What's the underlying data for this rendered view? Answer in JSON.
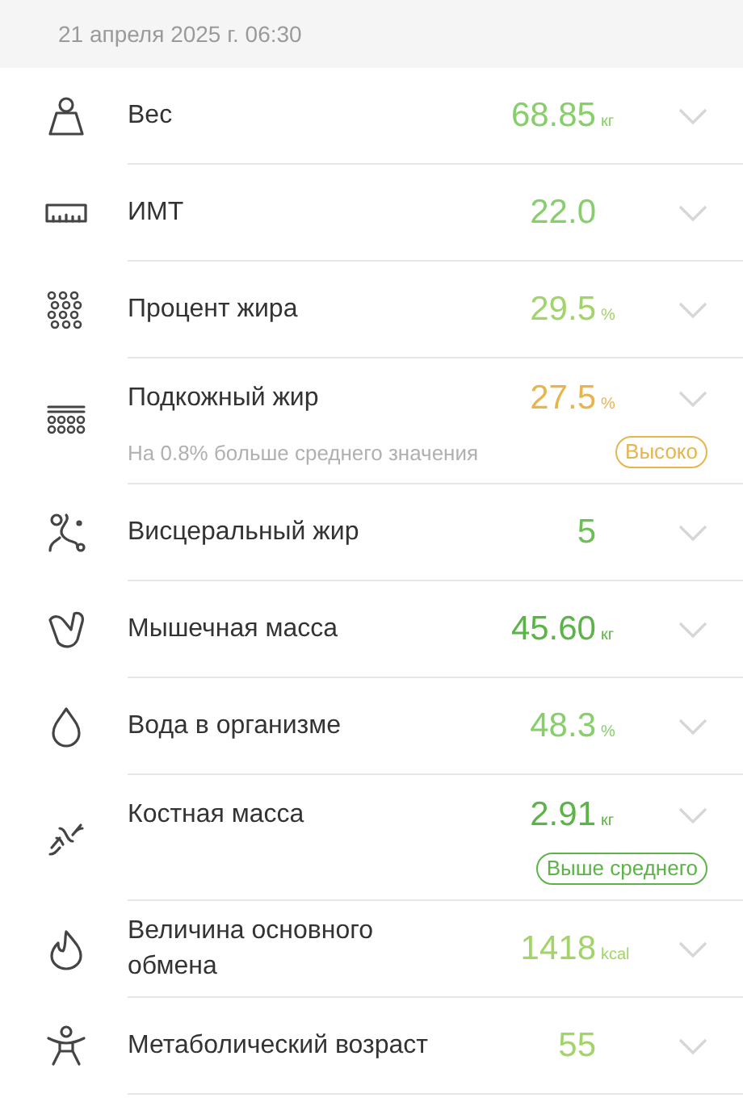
{
  "date": "21 апреля 2025 г. 06:30",
  "metrics": [
    {
      "label": "Вес",
      "value": "68.85",
      "unit": "кг",
      "color": "#86cf6a"
    },
    {
      "label": "ИМТ",
      "value": "22.0",
      "color": "#86cf6a"
    },
    {
      "label": "Процент жира",
      "value": "29.5",
      "unit": "%",
      "color": "#a3d46a"
    },
    {
      "label": "Подкожный жир",
      "value": "27.5",
      "unit": "%",
      "color": "#e8b44e",
      "note": "На 0.8% больше среднего значения",
      "badge": "Высоко"
    },
    {
      "label": "Висцеральный жир",
      "value": "5",
      "color": "#6cbf55"
    },
    {
      "label": "Мышечная масса",
      "value": "45.60",
      "unit": "кг",
      "color": "#5cb449"
    },
    {
      "label": "Вода в организме",
      "value": "48.3",
      "unit": "%",
      "color": "#86cf6a"
    },
    {
      "label": "Костная масса",
      "value": "2.91",
      "unit": "кг",
      "color": "#5cb449",
      "badge": "Выше среднего"
    },
    {
      "label": "Величина основного обмена",
      "value": "1418",
      "unit": "kcal",
      "color": "#a3d46a"
    },
    {
      "label": "Метаболический возраст",
      "value": "55",
      "color": "#a3d46a"
    }
  ]
}
